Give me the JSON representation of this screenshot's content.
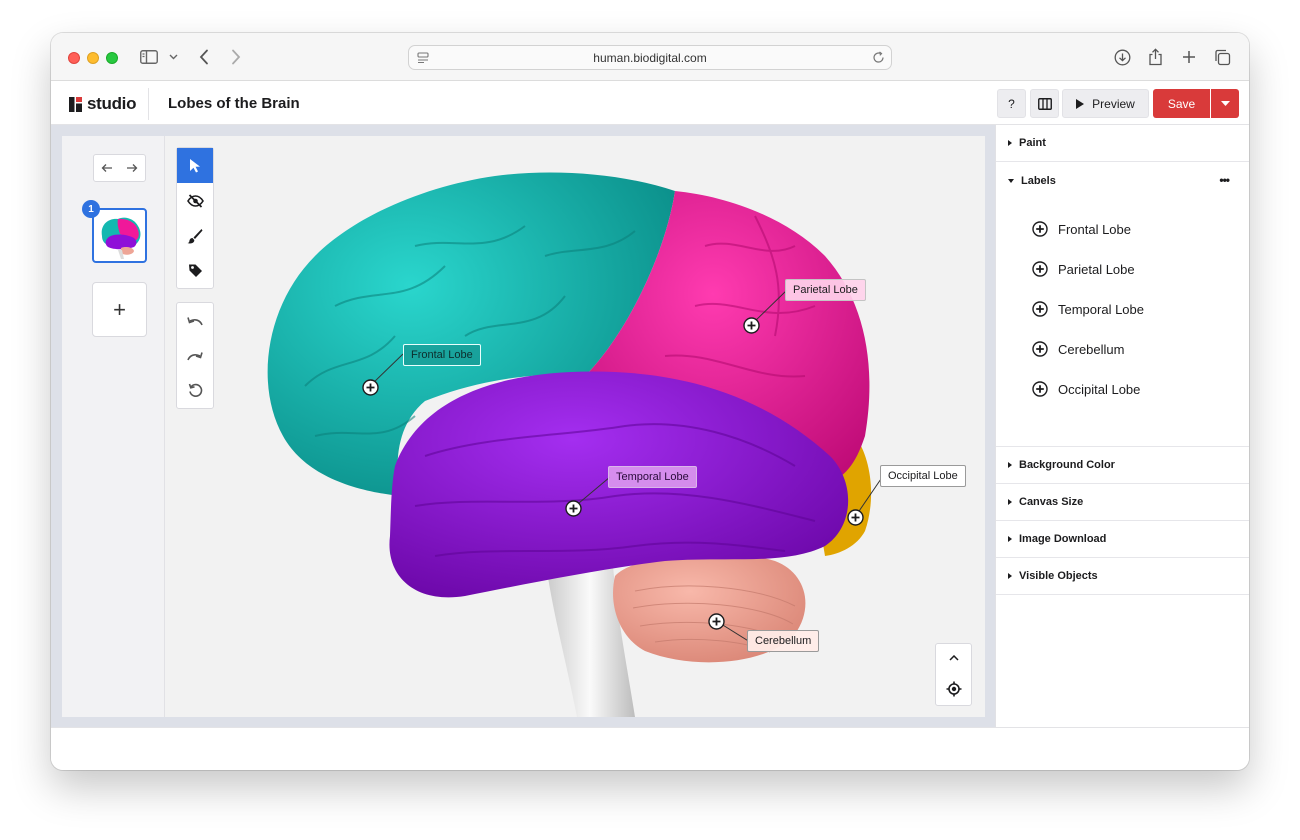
{
  "browser": {
    "url": "human.biodigital.com"
  },
  "app": {
    "logo_text": "studio",
    "document_title": "Lobes of the Brain",
    "help_label": "?",
    "preview_label": "Preview",
    "save_label": "Save"
  },
  "slides": {
    "current_badge": "1",
    "add_label": "+"
  },
  "canvas_labels": {
    "frontal": "Frontal Lobe",
    "parietal": "Parietal Lobe",
    "temporal": "Temporal Lobe",
    "occipital": "Occipital Lobe",
    "cerebellum": "Cerebellum"
  },
  "lobe_colors": {
    "frontal": "#14b8b0",
    "parietal": "#f0189a",
    "temporal": "#8f0fd8",
    "occipital": "#e0a400",
    "cerebellum": "#eea596",
    "brainstem": "#e4e4e4"
  },
  "panel": {
    "sections": {
      "paint": "Paint",
      "labels": "Labels",
      "background_color": "Background Color",
      "canvas_size": "Canvas Size",
      "image_download": "Image Download",
      "visible_objects": "Visible Objects"
    },
    "labels_more": "•••",
    "label_items": [
      "Frontal Lobe",
      "Parietal Lobe",
      "Temporal Lobe",
      "Cerebellum",
      "Occipital Lobe"
    ]
  },
  "accent_colors": {
    "primary": "#2f72e0",
    "save": "#d93a3a"
  }
}
